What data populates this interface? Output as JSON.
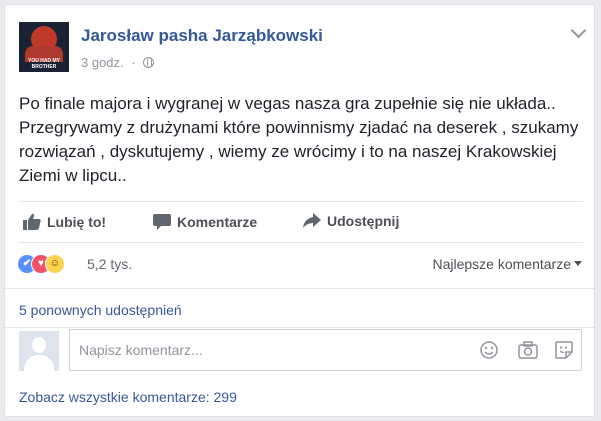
{
  "post": {
    "author": "Jarosław pasha Jarząbkowski",
    "time": "3 godz.",
    "avatar_caption": "YOU HAD MY BROTHER",
    "text": "Po finale majora i wygranej w vegas nasza gra zupełnie się nie układa.. Przegrywamy z drużynami które powinnismy zjadać na deserek , szukamy rozwiązań , dyskutujemy , wiemy ze wrócimy i to na naszej Krakowskiej Ziemi w lipcu.."
  },
  "actions": {
    "like": "Lubię to!",
    "comment": "Komentarze",
    "share": "Udostępnij"
  },
  "reactions": {
    "count": "5,2 tys.",
    "types": [
      "like-icon",
      "love-icon",
      "haha-icon"
    ],
    "colors": {
      "like": "#5890ff",
      "love": "#f25268",
      "haha": "#fcd34f"
    }
  },
  "sort_label": "Najlepsze komentarze",
  "shares_label": "5 ponownych udostępnień",
  "comment_box": {
    "placeholder": "Napisz komentarz..."
  },
  "view_all_label": "Zobacz wszystkie komentarze: 299"
}
